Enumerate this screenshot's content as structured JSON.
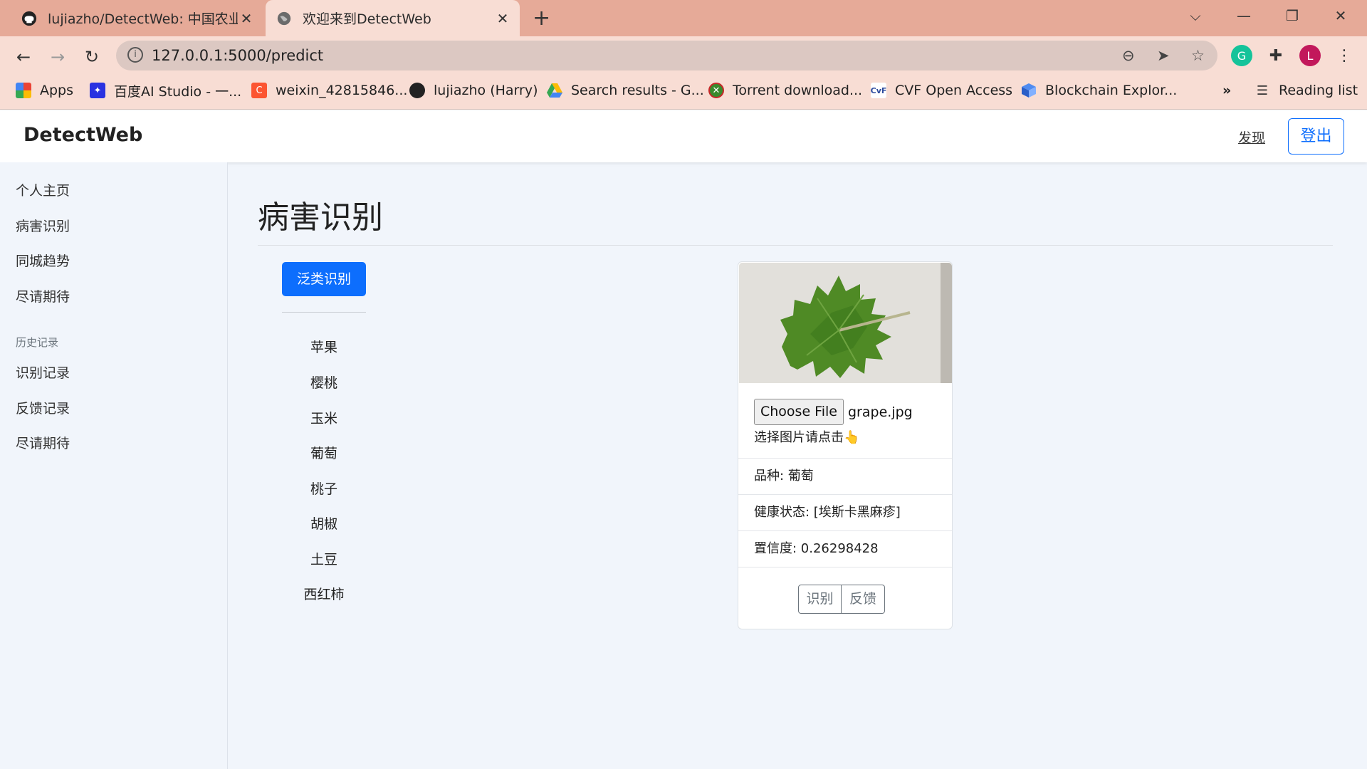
{
  "browser": {
    "tabs": [
      {
        "title": "lujiazho/DetectWeb: 中国农业大学",
        "icon": "github-icon"
      },
      {
        "title": "欢迎来到DetectWeb",
        "icon": "globe-icon"
      }
    ],
    "url": "127.0.0.1:5000/predict",
    "bookmarks": [
      {
        "label": "Apps",
        "icon": "apps-grid-icon"
      },
      {
        "label": "百度AI Studio - 一...",
        "icon": "aistudio-icon"
      },
      {
        "label": "weixin_42815846...",
        "icon": "csdn-icon"
      },
      {
        "label": "lujiazho (Harry)",
        "icon": "github-icon"
      },
      {
        "label": "Search results - G...",
        "icon": "drive-icon"
      },
      {
        "label": "Torrent download...",
        "icon": "torrent-icon"
      },
      {
        "label": "CVF Open Access",
        "icon": "cvf-icon"
      },
      {
        "label": "Blockchain Explor...",
        "icon": "blockchain-icon"
      }
    ],
    "more_bookmarks": "»",
    "reading_list": "Reading list",
    "profile_initial": "L",
    "colors": {
      "tabstrip": "#e6aa98",
      "toolbar": "#f8ddd4",
      "profile": "#c2185b",
      "grammarly": "#15c39a"
    }
  },
  "navbar": {
    "brand": "DetectWeb",
    "discover": "发现",
    "logout": "登出",
    "accent": "#0d6efd"
  },
  "sidebar": {
    "items": [
      "个人主页",
      "病害识别",
      "同城趋势",
      "尽请期待"
    ],
    "history_heading": "历史记录",
    "history_items": [
      "识别记录",
      "反馈记录",
      "尽请期待"
    ]
  },
  "main": {
    "title": "病害识别",
    "general_button": "泛类识别",
    "categories": [
      "苹果",
      "樱桃",
      "玉米",
      "葡萄",
      "桃子",
      "胡椒",
      "土豆",
      "西红柿"
    ]
  },
  "card": {
    "choose_file": "Choose File",
    "file_name": "grape.jpg",
    "hint": "选择图片请点击👆",
    "variety": "品种: 葡萄",
    "health": "健康状态: [埃斯卡黑麻疹]",
    "confidence": "置信度: 0.26298428",
    "identify_button": "识别",
    "feedback_button": "反馈"
  }
}
